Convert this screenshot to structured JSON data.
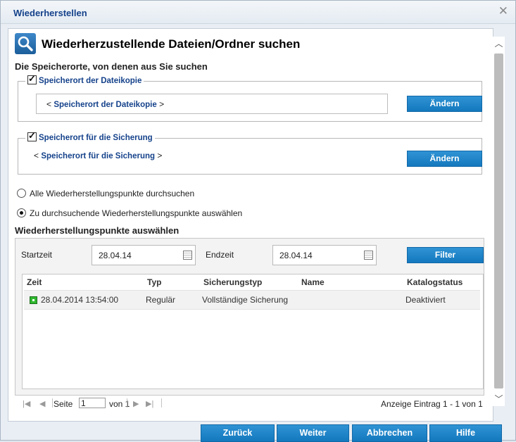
{
  "window": {
    "title": "Wiederherstellen"
  },
  "header": {
    "title": "Wiederherzustellende Dateien/Ordner suchen",
    "subtitle": "Die Speicherorte, von denen aus Sie suchen"
  },
  "file_copy": {
    "legend": "Speicherort der Dateikopie",
    "checked": true,
    "open": "<",
    "value": "Speicherort der Dateikopie",
    "close": ">",
    "button": "Ändern"
  },
  "backup": {
    "legend": "Speicherort für die Sicherung",
    "checked": true,
    "open": "<",
    "value": "Speicherort für die Sicherung",
    "close": ">",
    "button": "Ändern"
  },
  "search_mode": {
    "options": [
      {
        "label": "Alle Wiederherstellungspunkte durchsuchen",
        "selected": false
      },
      {
        "label": "Zu durchsuchende Wiederherstellungspunkte auswählen",
        "selected": true
      }
    ]
  },
  "points": {
    "title": "Wiederherstellungspunkte auswählen",
    "start_label": "Startzeit",
    "start_value": "28.04.14",
    "end_label": "Endzeit",
    "end_value": "28.04.14",
    "filter_button": "Filter",
    "columns": [
      "Zeit",
      "Typ",
      "Sicherungstyp",
      "Name",
      "Katalogstatus"
    ],
    "rows": [
      {
        "zeit": "28.04.2014 13:54:00",
        "typ": "Regulär",
        "sicherungstyp": "Vollständige Sicherung",
        "name": "",
        "katalogstatus": "Deaktiviert"
      }
    ]
  },
  "pager": {
    "page_label": "Seite",
    "page_value": "1",
    "of_label": "von 1",
    "display_text": "Anzeige Eintrag 1 - 1 von 1"
  },
  "footer": {
    "back": "Zurück",
    "next": "Weiter",
    "cancel": "Abbrechen",
    "help": "Hilfe"
  },
  "colors": {
    "accent": "#1f87c9",
    "link": "#15428b",
    "title": "#15428b"
  }
}
